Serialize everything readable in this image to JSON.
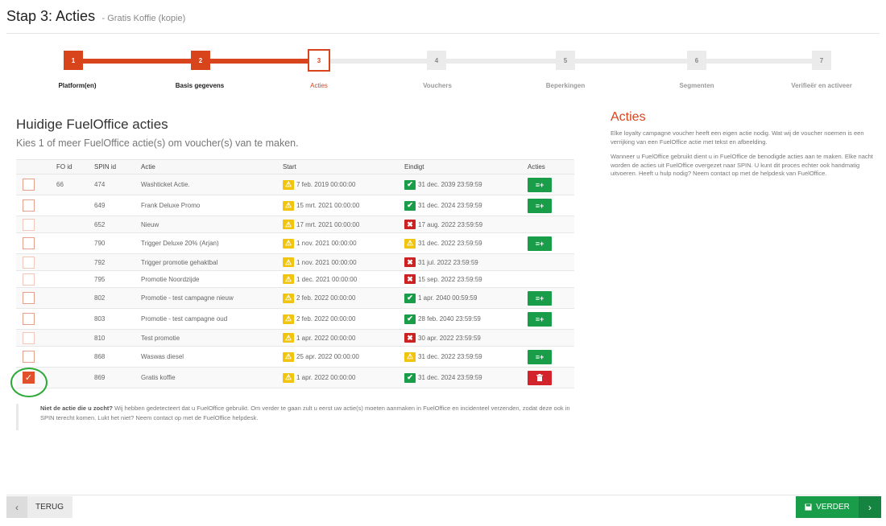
{
  "header": {
    "title": "Stap 3: Acties",
    "subtitle": "- Gratis Koffie (kopie)"
  },
  "steps": [
    {
      "num": "1",
      "label": "Platform(en)",
      "state": "done"
    },
    {
      "num": "2",
      "label": "Basis gegevens",
      "state": "done"
    },
    {
      "num": "3",
      "label": "Acties",
      "state": "active"
    },
    {
      "num": "4",
      "label": "Vouchers",
      "state": "todo"
    },
    {
      "num": "5",
      "label": "Beperkingen",
      "state": "todo"
    },
    {
      "num": "6",
      "label": "Segmenten",
      "state": "todo"
    },
    {
      "num": "7",
      "label": "Verifieër en activeer",
      "state": "todo"
    }
  ],
  "main": {
    "title": "Huidige FuelOffice acties",
    "subtitle": "Kies 1 of meer FuelOffice actie(s) om voucher(s) van te maken."
  },
  "table": {
    "columns": [
      "FO id",
      "SPIN id",
      "Actie",
      "Start",
      "Eindigt",
      "Acties"
    ],
    "rows": [
      {
        "fo": "66",
        "spin": "474",
        "actie": "Washticket Actie.",
        "start": "7 feb. 2019 00:00:00",
        "end": "31 dec. 2039 23:59:59",
        "endStatus": "ok",
        "btn": "add",
        "checked": false
      },
      {
        "fo": "",
        "spin": "649",
        "actie": "Frank Deluxe Promo",
        "start": "15 mrt. 2021 00:00:00",
        "end": "31 dec. 2024 23:59:59",
        "endStatus": "ok",
        "btn": "add",
        "checked": false
      },
      {
        "fo": "",
        "spin": "652",
        "actie": "Nieuw",
        "start": "17 mrt. 2021 00:00:00",
        "end": "17 aug. 2022 23:59:59",
        "endStatus": "bad",
        "btn": "",
        "checked": false
      },
      {
        "fo": "",
        "spin": "790",
        "actie": "Trigger Deluxe 20% (Arjan)",
        "start": "1 nov. 2021 00:00:00",
        "end": "31 dec. 2022 23:59:59",
        "endStatus": "warn",
        "btn": "add",
        "checked": false
      },
      {
        "fo": "",
        "spin": "792",
        "actie": "Trigger promotie gehaktbal",
        "start": "1 nov. 2021 00:00:00",
        "end": "31 jul. 2022 23:59:59",
        "endStatus": "bad",
        "btn": "",
        "checked": false
      },
      {
        "fo": "",
        "spin": "795",
        "actie": "Promotie Noordzijde",
        "start": "1 dec. 2021 00:00:00",
        "end": "15 sep. 2022 23:59:59",
        "endStatus": "bad",
        "btn": "",
        "checked": false
      },
      {
        "fo": "",
        "spin": "802",
        "actie": "Promotie - test campagne nieuw",
        "start": "2 feb. 2022 00:00:00",
        "end": "1 apr. 2040 00:59:59",
        "endStatus": "ok",
        "btn": "add",
        "checked": false
      },
      {
        "fo": "",
        "spin": "803",
        "actie": "Promotie - test campagne oud",
        "start": "2 feb. 2022 00:00:00",
        "end": "28 feb. 2040 23:59:59",
        "endStatus": "ok",
        "btn": "add",
        "checked": false
      },
      {
        "fo": "",
        "spin": "810",
        "actie": "Test promotie",
        "start": "1 apr. 2022 00:00:00",
        "end": "30 apr. 2022 23:59:59",
        "endStatus": "bad",
        "btn": "",
        "checked": false
      },
      {
        "fo": "",
        "spin": "868",
        "actie": "Waswas diesel",
        "start": "25 apr. 2022 00:00:00",
        "end": "31 dec. 2022 23:59:59",
        "endStatus": "warn",
        "btn": "add",
        "checked": false
      },
      {
        "fo": "",
        "spin": "869",
        "actie": "Gratis koffie",
        "start": "1 apr. 2022 00:00:00",
        "end": "31 dec. 2024 23:59:59",
        "endStatus": "ok",
        "btn": "delete",
        "checked": true
      }
    ]
  },
  "note": {
    "bold": "Niet de actie die u zocht?",
    "text": " Wij hebben gedetecteert dat u FuelOffice gebruikt. Om verder te gaan zult u eerst uw actie(s) moeten aanmaken in FuelOffice en incidenteel verzenden, zodat deze ook in SPIN terecht komen. Lukt het niet? Neem contact op met de FuelOffice helpdesk."
  },
  "side": {
    "title": "Acties",
    "p1": "Elke loyalty campagne voucher heeft een eigen actie nodig. Wat wij de voucher noemen is een verrijking van een FuelOffice actie met tekst en afbeelding.",
    "p2": "Wanneer u FuelOffice gebruikt dient u in FuelOffice de benodigde acties aan te maken. Elke nacht worden de acties uit FuelOffice overgezet naar SPIN. U kunt dit proces echter ook handmatig uitvoeren. Heeft u hulp nodig? Neem contact op met de helpdesk van FuelOffice."
  },
  "footer": {
    "back_label": "TERUG",
    "next_label": "VERDER"
  },
  "colors": {
    "accent": "#d8441c",
    "success": "#1a9d49",
    "danger": "#d3232b",
    "warning": "#f1c40f"
  },
  "icons": {
    "add": "list-plus-icon",
    "delete": "trash-icon",
    "ok": "check-icon",
    "bad": "x-icon",
    "warn": "warning-icon"
  }
}
